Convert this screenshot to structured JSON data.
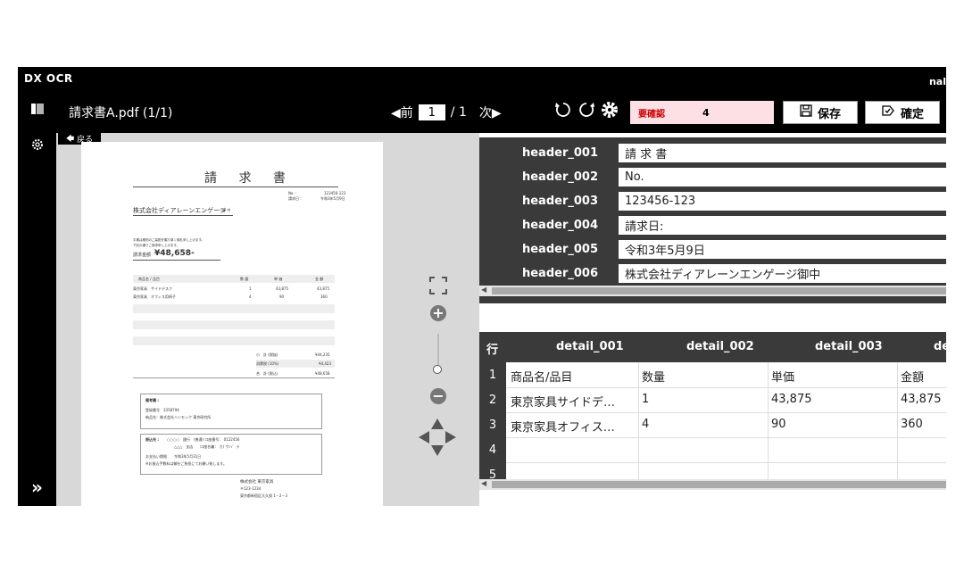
{
  "app": {
    "brand": "DX OCR",
    "username": "nal"
  },
  "rail": {
    "menu_icon": "panel-icon",
    "settings_icon": "gear-icon",
    "expand_icon": "double-chevron-right-icon"
  },
  "toolbar": {
    "file_title": "請求書A.pdf (1/1)",
    "prev_label": "◀前",
    "page_current": "1",
    "page_total": "/ 1",
    "next_label": "次▶",
    "needs_review_label": "要確認",
    "needs_review_count": "4",
    "save_label": "保存",
    "confirm_label": "確定"
  },
  "viewer": {
    "back_label": "戻る",
    "document": {
      "title": "請 求 書",
      "no_label": "No. :",
      "no_value": "123456-123",
      "date_label": "請求日 :",
      "date_value": "令和3年5月9日",
      "recipient": "株式会社ディアレーンエンゲージ",
      "recipient_suffix": "御 中",
      "note1": "平素は格別のご高配を賜り厚く御礼申し上げます。",
      "note2": "下記の通りご請求申し上げます。",
      "total_label": "請求金額",
      "total_value": "¥48,658-",
      "col_item": "商品名 / 品目",
      "col_qty": "数 量",
      "col_price": "単 価",
      "col_amount": "金 額",
      "items": [
        {
          "name": "東京家具　サイドデスク",
          "qty": "1",
          "price": "43,875",
          "amount": "43,875"
        },
        {
          "name": "東京家具　オフィス用椅子",
          "qty": "4",
          "price": "90",
          "amount": "360"
        }
      ],
      "subtotal_label": "小　計 (税抜)",
      "subtotal_value": "¥44,235",
      "tax_label": "消費税 (10%)",
      "tax_value": "¥4,423",
      "grand_label": "合　計 (税込)",
      "grand_value": "¥48,658",
      "remarks_title": "備考欄 :",
      "remarks_line1": "登録番号　3358794",
      "remarks_line2": "納品先：株式会社ハンモック 東京研究所",
      "bank_label": "振込先 :",
      "bank_line1": "○○○○　銀行　(普通) 口座番号： 0122456",
      "bank_line2": "△△△　支店　　口座名義： カ) ワハ゛ラ",
      "due_line": "お支払い期限　　令和3年5月31日",
      "fee_line": "※お振込手数料は御社ご負担にてお願い致します。",
      "issuer_name": "株式会社 東京家具",
      "issuer_zip": "〒123-1234",
      "issuer_address": "東京都新宿区大久保 1－2－3"
    }
  },
  "header_fields": [
    {
      "key": "header_001",
      "value": "請 求 書"
    },
    {
      "key": "header_002",
      "value": "No."
    },
    {
      "key": "header_003",
      "value": "123456-123"
    },
    {
      "key": "header_004",
      "value": "請求日:"
    },
    {
      "key": "header_005",
      "value": "令和3年5月9日"
    },
    {
      "key": "header_006",
      "value": "株式会社ディアレーンエンゲージ御中"
    }
  ],
  "detail_table": {
    "row_header": "行",
    "columns": [
      "detail_001",
      "detail_002",
      "detail_003",
      "de"
    ],
    "rows": [
      {
        "n": "1",
        "cells": [
          "商品名/品目",
          "数量",
          "単価",
          "金額"
        ]
      },
      {
        "n": "2",
        "cells": [
          "東京家具サイドデ…",
          "1",
          "43,875",
          "43,875"
        ]
      },
      {
        "n": "3",
        "cells": [
          "東京家具オフィス…",
          "4",
          "90",
          "360"
        ]
      },
      {
        "n": "4",
        "cells": [
          "",
          "",
          "",
          ""
        ]
      },
      {
        "n": "5",
        "cells": [
          "",
          "",
          "",
          ""
        ]
      }
    ]
  }
}
